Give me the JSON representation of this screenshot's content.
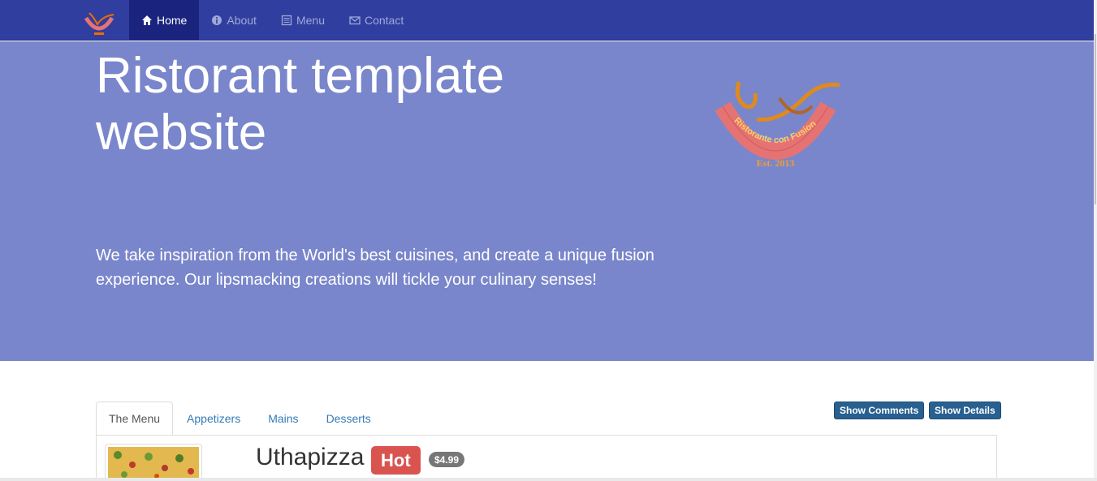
{
  "nav": {
    "items": [
      {
        "label": "Home",
        "icon": "home-icon",
        "active": true
      },
      {
        "label": "About",
        "icon": "info-circle-icon",
        "active": false
      },
      {
        "label": "Menu",
        "icon": "list-icon",
        "active": false
      },
      {
        "label": "Contact",
        "icon": "envelope-icon",
        "active": false
      }
    ]
  },
  "hero": {
    "title_line1": "Ristorant template",
    "title_line2": "website",
    "tagline_line1": "We take inspiration from the World's best cuisines, and create a unique fusion",
    "tagline_line2": "experience. Our lipsmacking creations will tickle your culinary senses!",
    "logo_text": "Ristorante con Fusion",
    "logo_est": "Est. 2013"
  },
  "tabs": [
    {
      "label": "The Menu",
      "active": true
    },
    {
      "label": "Appetizers",
      "active": false
    },
    {
      "label": "Mains",
      "active": false
    },
    {
      "label": "Desserts",
      "active": false
    }
  ],
  "buttons": {
    "show_comments": "Show Comments",
    "show_details": "Show Details"
  },
  "dish": {
    "name": "Uthapizza",
    "badge": "Hot",
    "price": "$4.99"
  },
  "colors": {
    "navbar": "#303f9f",
    "navbar_active": "#1a237e",
    "jumbotron": "#7986cb",
    "button": "#286090",
    "hot_badge": "#d9534f",
    "price_badge": "#777777"
  }
}
